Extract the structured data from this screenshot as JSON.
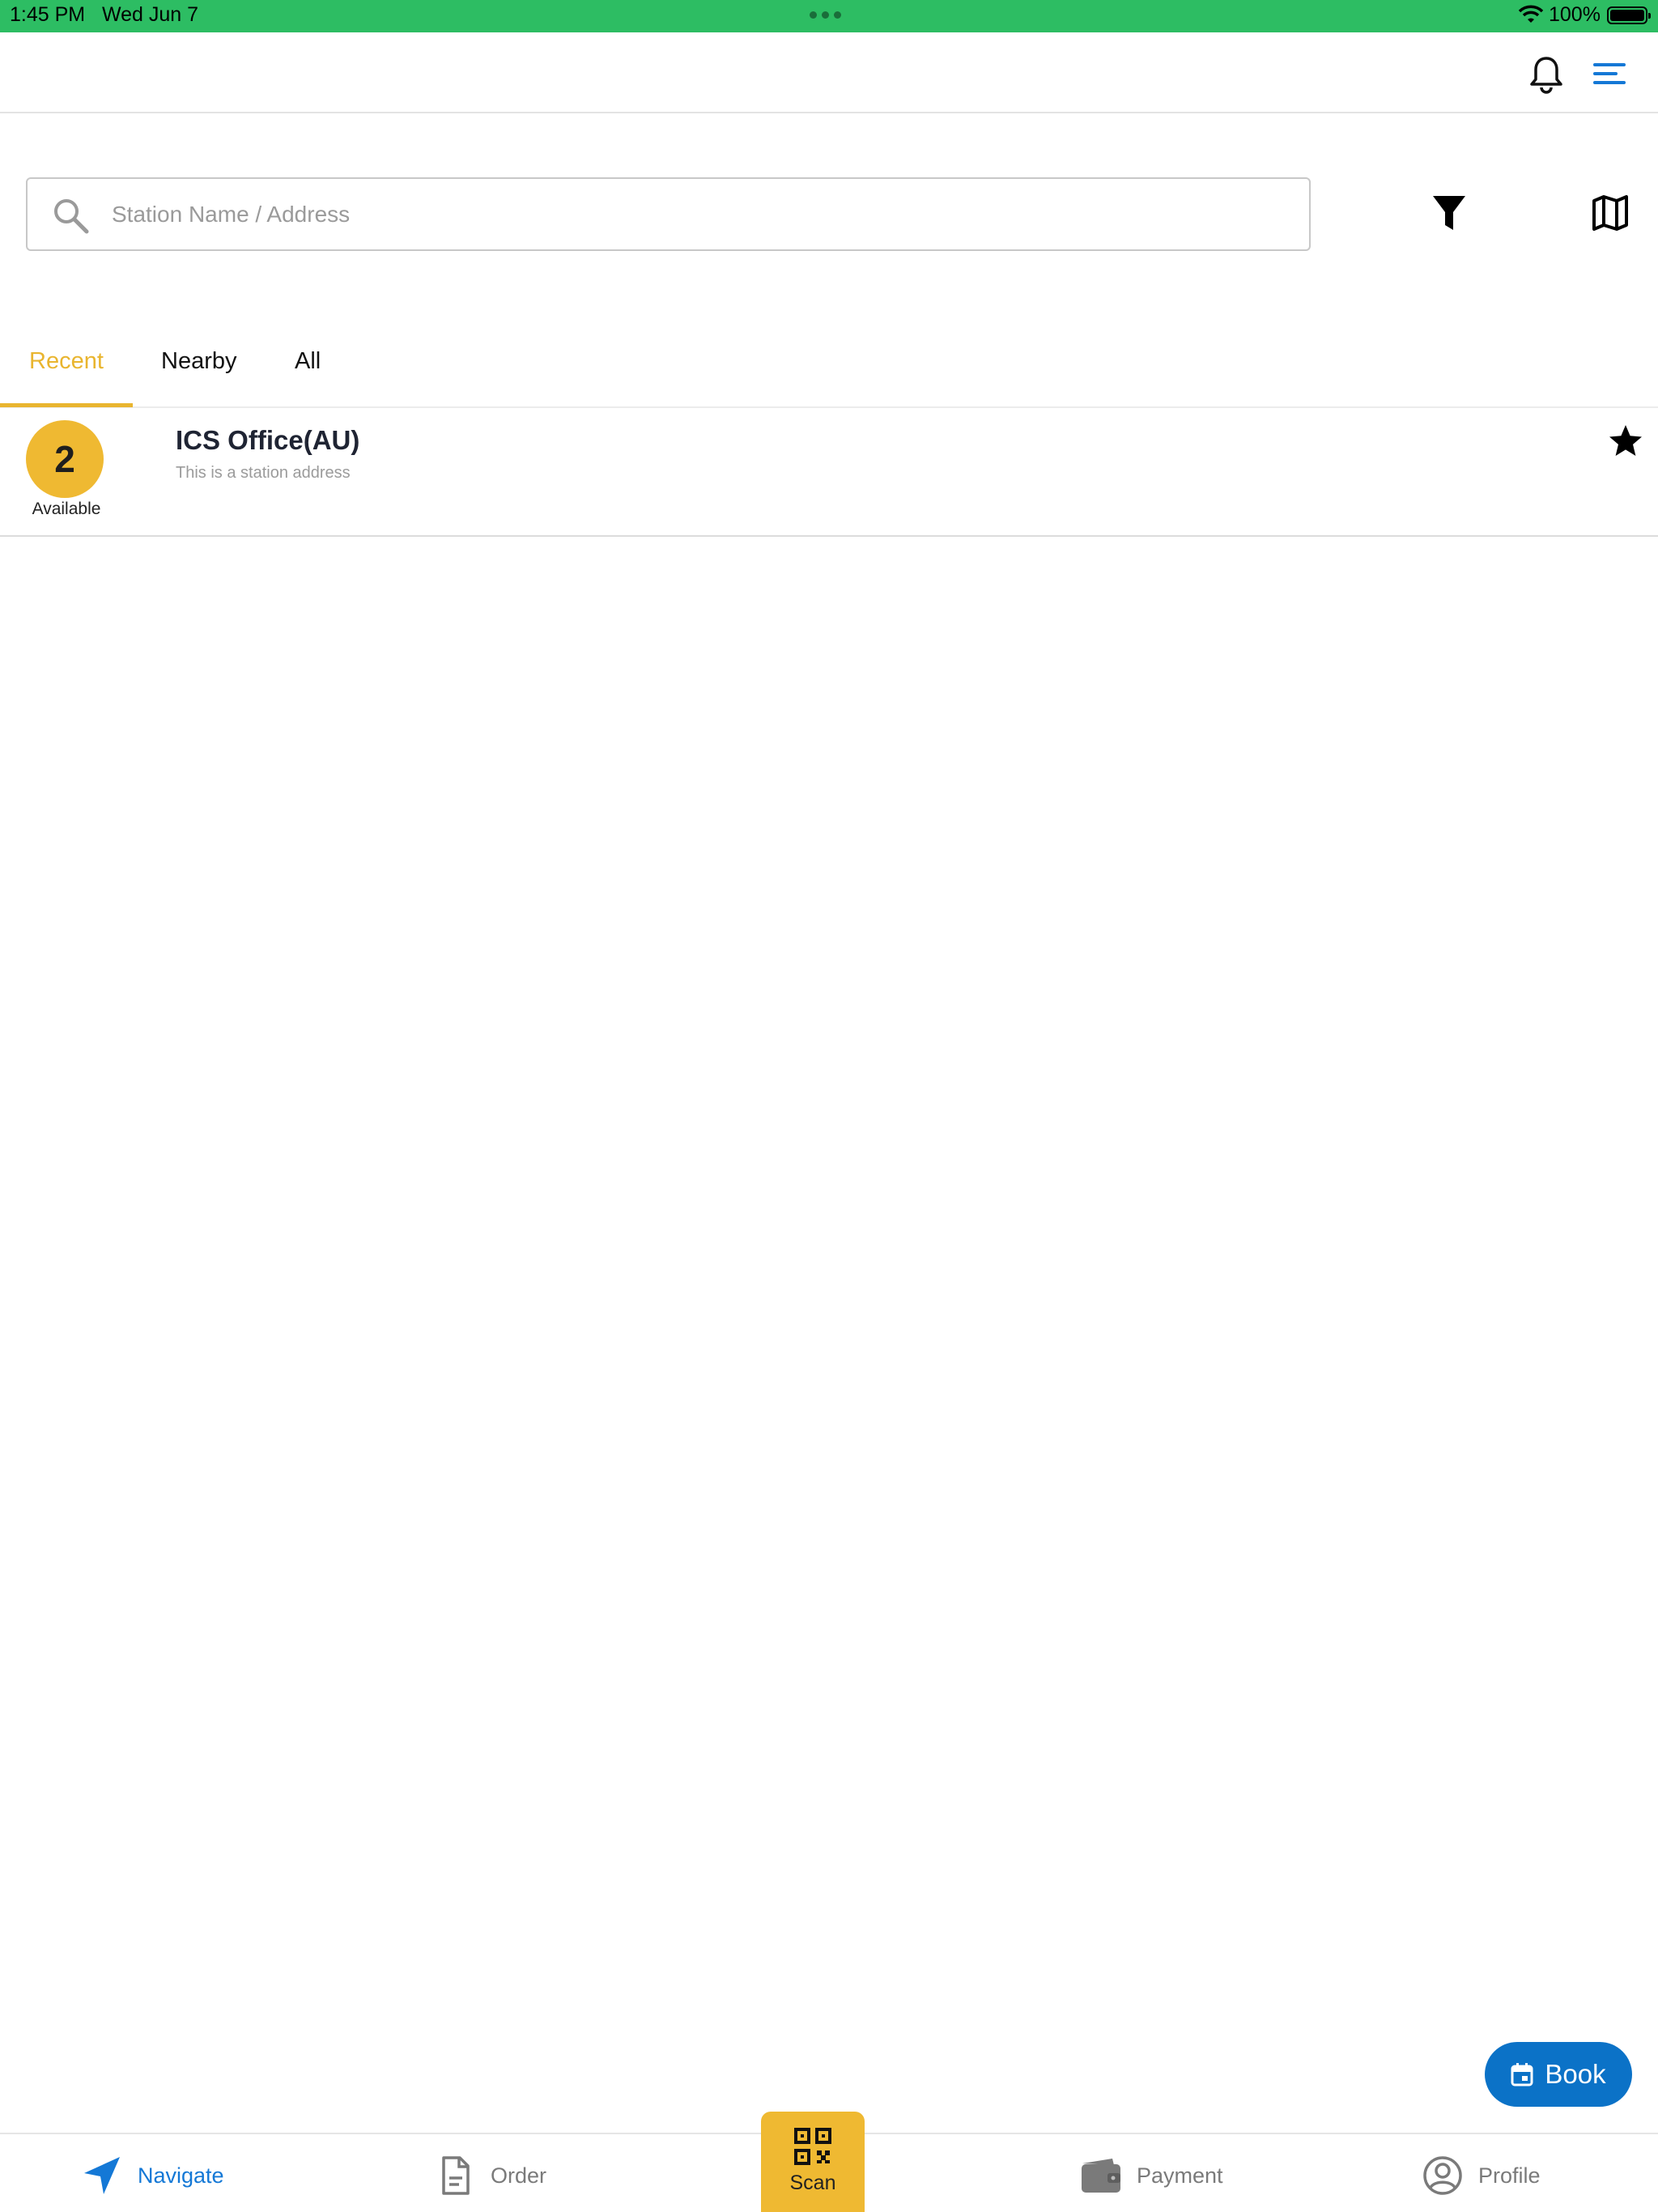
{
  "status_bar": {
    "time": "1:45 PM",
    "date": "Wed Jun 7",
    "battery_percent": "100%",
    "battery_level": 1.0
  },
  "header": {
    "icons": [
      "bell-icon",
      "menu-icon"
    ],
    "menu_icon_color": "#1478d6"
  },
  "search": {
    "placeholder": "Station Name / Address",
    "value": ""
  },
  "toolbar_icons": [
    "filter-icon",
    "map-icon"
  ],
  "tabs": [
    {
      "label": "Recent",
      "active": true
    },
    {
      "label": "Nearby",
      "active": false
    },
    {
      "label": "All",
      "active": false
    }
  ],
  "stations": [
    {
      "available_count": "2",
      "available_label": "Available",
      "name": "ICS Office(AU)",
      "address": "This is a station address",
      "favorite": true
    }
  ],
  "book_button": {
    "label": "Book",
    "icon": "calendar-icon"
  },
  "bottom_nav": {
    "items": [
      {
        "label": "Navigate",
        "icon": "navigate-arrow-icon",
        "active": true
      },
      {
        "label": "Order",
        "icon": "document-icon",
        "active": false
      },
      {
        "label": "Scan",
        "icon": "qr-code-icon",
        "active": false
      },
      {
        "label": "Payment",
        "icon": "wallet-icon",
        "active": false
      },
      {
        "label": "Profile",
        "icon": "profile-icon",
        "active": false
      }
    ]
  },
  "colors": {
    "status_bar": "#2dbd63",
    "accent_yellow": "#efb932",
    "tab_active": "#e9b52f",
    "primary_blue": "#1478d6",
    "book_blue": "#0b72c7"
  }
}
